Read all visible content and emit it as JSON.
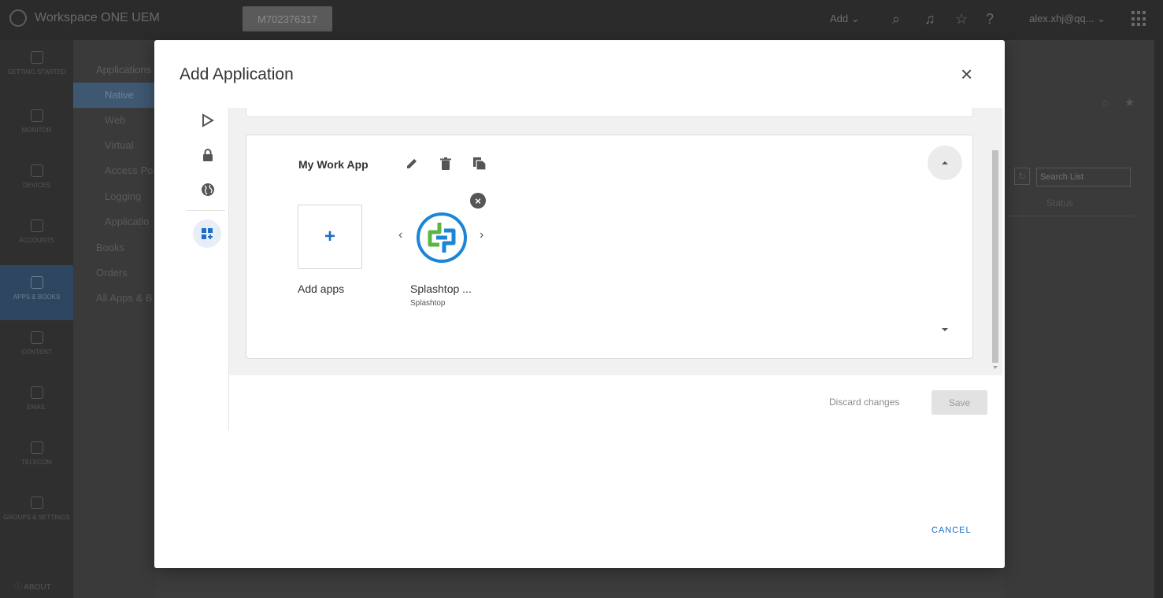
{
  "topbar": {
    "brand": "Workspace ONE UEM",
    "org": "M702376317",
    "add": "Add ⌄",
    "user": "alex.xhj@qq... ⌄"
  },
  "leftnav": {
    "items": [
      {
        "label": "GETTING STARTED"
      },
      {
        "label": "MONITOR"
      },
      {
        "label": "DEVICES"
      },
      {
        "label": "ACCOUNTS"
      },
      {
        "label": "APPS & BOOKS"
      },
      {
        "label": "CONTENT"
      },
      {
        "label": "EMAIL"
      },
      {
        "label": "TELECOM"
      },
      {
        "label": "GROUPS & SETTINGS"
      }
    ],
    "about": "ABOUT"
  },
  "subnav": {
    "items": [
      "Applications",
      "Native",
      "Web",
      "Virtual",
      "Access Po",
      "Logging",
      "Applicatio",
      "Books",
      "Orders",
      "All Apps & B"
    ]
  },
  "background": {
    "search_placeholder": "Search List",
    "status": "Status"
  },
  "modal": {
    "title": "Add Application",
    "close": "×",
    "card": {
      "title": "My Work App",
      "add_label": "Add apps",
      "app_name": "Splashtop ...",
      "app_vendor": "Splashtop"
    },
    "discard": "Discard changes",
    "save": "Save",
    "cancel": "CANCEL"
  },
  "icons": {
    "rail": [
      "google-play-icon",
      "lock-icon",
      "globe-icon",
      "add-widget-icon"
    ],
    "card_actions": [
      "edit-icon",
      "delete-icon",
      "copy-icon"
    ]
  },
  "colors": {
    "accent": "#1d6fc4",
    "splashtop_blue": "#1b86d6",
    "splashtop_green": "#5db446"
  }
}
